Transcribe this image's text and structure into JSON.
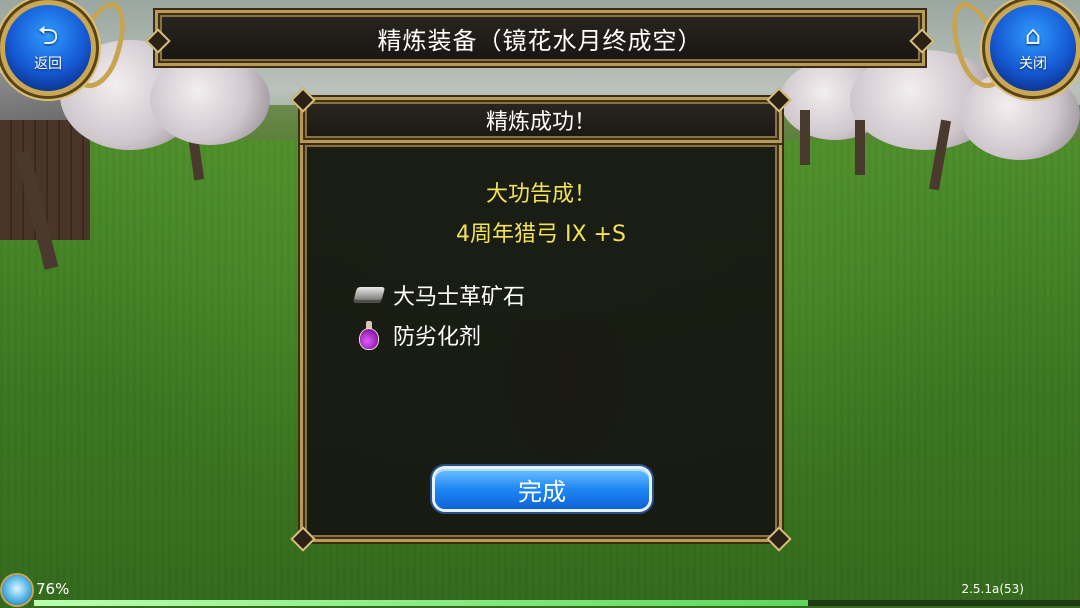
{
  "title_bar": {
    "title": "精炼装备（镜花水月终成空）"
  },
  "back_button": {
    "label": "返回",
    "icon": "back-arrow-icon"
  },
  "close_button": {
    "label": "关闭",
    "icon": "home-icon"
  },
  "dialog": {
    "title": "精炼成功！",
    "headline": "大功告成！",
    "item_name": "4周年猎弓 IX +S",
    "materials": [
      {
        "name": "大马士革矿石",
        "icon": "ore-ingot-icon"
      },
      {
        "name": "防劣化剂",
        "icon": "potion-icon"
      }
    ],
    "done_label": "完成"
  },
  "status": {
    "battery_percent": "76%",
    "progress": 0.74,
    "version": "2.5.1a(53)"
  },
  "colors": {
    "headline": "#f2e257",
    "button_blue": "#1f87f5",
    "frame_gold": "#b89a55"
  }
}
